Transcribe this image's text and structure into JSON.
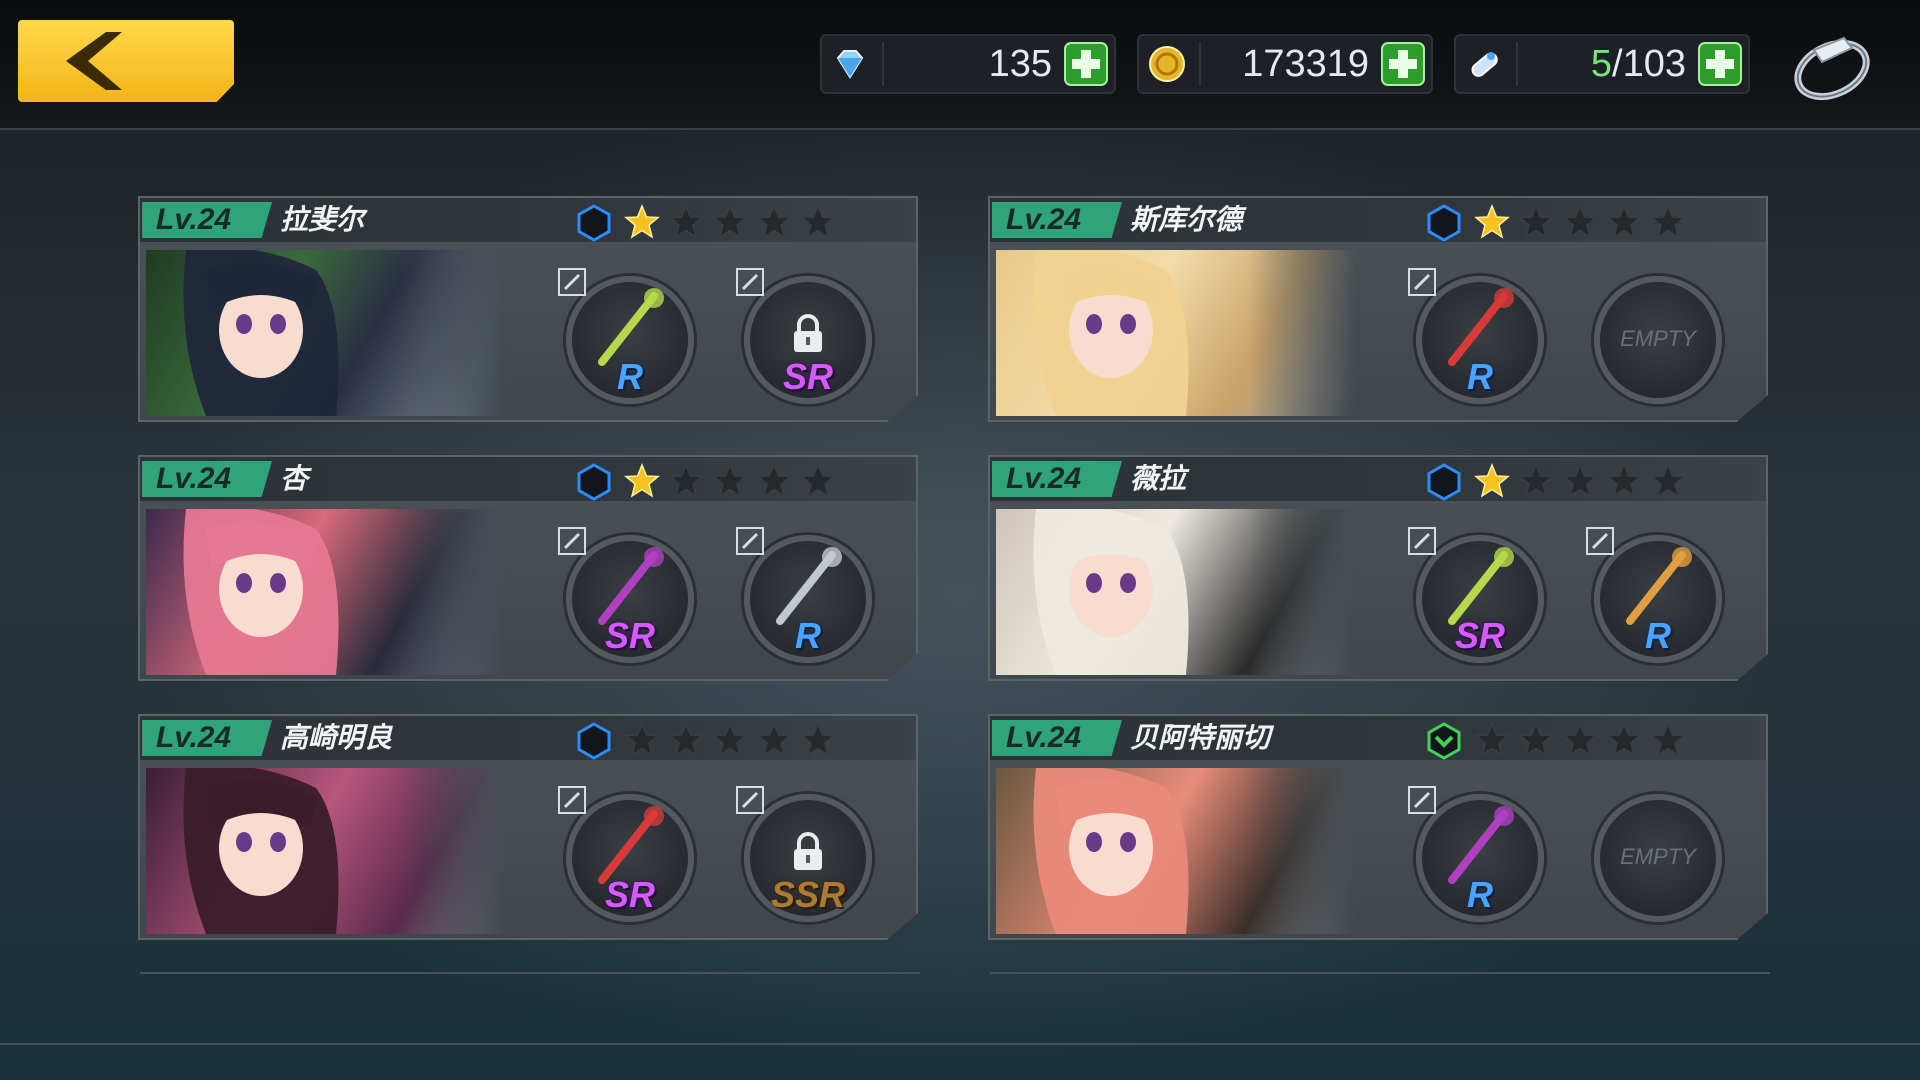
{
  "topbar": {
    "gems": {
      "value": "135",
      "icon": "gem-icon"
    },
    "gold": {
      "value": "173319",
      "icon": "coin-icon"
    },
    "stamina": {
      "current": "5",
      "max": "/103",
      "icon": "potion-icon"
    }
  },
  "characters": [
    {
      "level": "Lv.24",
      "name": "拉斐尔",
      "stars": 1,
      "badge_color": "#2a8cff",
      "slots": [
        {
          "rarity": "R",
          "locked": false
        },
        {
          "rarity": "SR",
          "locked": true
        }
      ]
    },
    {
      "level": "Lv.24",
      "name": "斯库尔德",
      "stars": 1,
      "badge_color": "#2a8cff",
      "slots": [
        {
          "rarity": "R",
          "locked": false
        },
        {
          "empty": "EMPTY"
        }
      ]
    },
    {
      "level": "Lv.24",
      "name": "杏",
      "stars": 1,
      "badge_color": "#2a8cff",
      "slots": [
        {
          "rarity": "SR",
          "locked": false
        },
        {
          "rarity": "R",
          "locked": false
        }
      ]
    },
    {
      "level": "Lv.24",
      "name": "薇拉",
      "stars": 1,
      "badge_color": "#2a8cff",
      "slots": [
        {
          "rarity": "SR",
          "locked": false
        },
        {
          "rarity": "R",
          "locked": false
        }
      ]
    },
    {
      "level": "Lv.24",
      "name": "高崎明良",
      "stars": 0,
      "badge_color": "#2a8cff",
      "slots": [
        {
          "rarity": "SR",
          "locked": false
        },
        {
          "rarity": "SSR",
          "locked": true
        }
      ]
    },
    {
      "level": "Lv.24",
      "name": "贝阿特丽切",
      "stars": 0,
      "badge_color": "#3fd35a",
      "slots": [
        {
          "rarity": "R",
          "locked": false
        },
        {
          "empty": "EMPTY"
        }
      ]
    }
  ],
  "colors": {
    "accent_yellow": "#f5c21f",
    "level_green": "#2fa37a",
    "plus_green": "#3fc83f"
  }
}
